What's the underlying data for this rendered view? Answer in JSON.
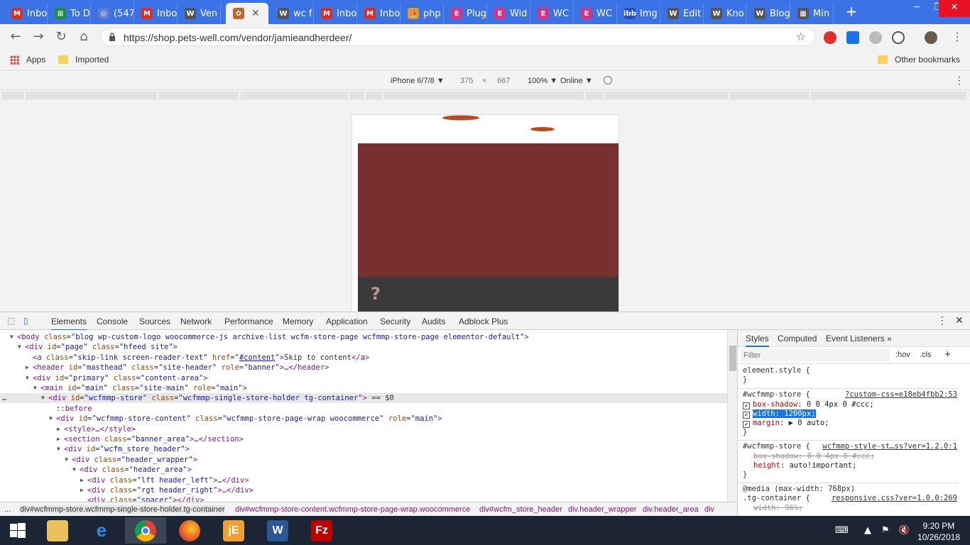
{
  "browser": {
    "tabs": [
      {
        "label": "Inbo",
        "icon": "gmail-icon",
        "color": "#d93025",
        "glyph": "M"
      },
      {
        "label": "To D",
        "icon": "sheets-icon",
        "color": "#1e8e3e",
        "glyph": "⊞"
      },
      {
        "label": "(547",
        "icon": "mail-icon",
        "color": "#5b7bd5",
        "glyph": "◎"
      },
      {
        "label": "Inbo",
        "icon": "gmail-icon",
        "color": "#d93025",
        "glyph": "M"
      },
      {
        "label": "Ven",
        "icon": "wp-icon",
        "color": "#555555",
        "glyph": "W"
      },
      {
        "label": "",
        "icon": "pets-well-icon",
        "color": "#c0672c",
        "glyph": "✿",
        "active": true
      },
      {
        "label": "wc f",
        "icon": "wp-icon",
        "color": "#555555",
        "glyph": "W"
      },
      {
        "label": "Inbo",
        "icon": "gmail-icon",
        "color": "#d93025",
        "glyph": "M"
      },
      {
        "label": "Inbo",
        "icon": "gmail-icon",
        "color": "#d93025",
        "glyph": "M"
      },
      {
        "label": "php",
        "icon": "sailboat-icon",
        "color": "#e09a28",
        "glyph": "⛵"
      },
      {
        "label": "Plug",
        "icon": "elementor-icon",
        "color": "#d63384",
        "glyph": "E"
      },
      {
        "label": "Wid",
        "icon": "elementor-icon",
        "color": "#d63384",
        "glyph": "E"
      },
      {
        "label": "WC",
        "icon": "elementor-icon",
        "color": "#d63384",
        "glyph": "E"
      },
      {
        "label": "WC",
        "icon": "elementor-icon",
        "color": "#d63384",
        "glyph": "E"
      },
      {
        "label": "Img",
        "icon": "ibb-icon",
        "color": "#2a4fb4",
        "glyph": "ibb"
      },
      {
        "label": "Edit",
        "icon": "wp-icon",
        "color": "#555555",
        "glyph": "W"
      },
      {
        "label": "Kno",
        "icon": "wp-icon",
        "color": "#555555",
        "glyph": "W"
      },
      {
        "label": "Blog",
        "icon": "wp-icon",
        "color": "#555555",
        "glyph": "W"
      },
      {
        "label": "Min",
        "icon": "film-icon",
        "color": "#555555",
        "glyph": "▦"
      }
    ],
    "new_tab": "+",
    "url": "https://shop.pets-well.com/vendor/jamieandherdeer/",
    "bookmarks": {
      "apps": "Apps",
      "imported": "Imported",
      "other": "Other bookmarks"
    }
  },
  "device_toolbar": {
    "device": "iPhone 6/7/8 ▼",
    "width": "375",
    "times": "×",
    "height": "667",
    "zoom": "100% ▼",
    "network": "Online ▼"
  },
  "page_preview": {
    "banner_color": "#772f30",
    "bar_color": "#3a3a3a",
    "placeholder_glyph": "?"
  },
  "devtools": {
    "tabs": [
      "Elements",
      "Console",
      "Sources",
      "Network",
      "Performance",
      "Memory",
      "Application",
      "Security",
      "Audits",
      "Adblock Plus"
    ],
    "dom_lines": [
      {
        "indent": 0,
        "arrow": "▼",
        "html": "<span class='tag'>&lt;body</span> <span class='attr'>class</span>=<span class='val'>\"blog wp-custom-logo woocommerce-js archive-list wcfm-store-page wcfmmp-store-page elementor-default\"</span><span class='tag'>&gt;</span>"
      },
      {
        "indent": 1,
        "arrow": "▼",
        "html": "<span class='tag'>&lt;div</span> <span class='attr'>id</span>=<span class='val'>\"page\"</span> <span class='attr'>class</span>=<span class='val'>\"hfeed site\"</span><span class='tag'>&gt;</span>"
      },
      {
        "indent": 2,
        "arrow": "",
        "html": "<span class='tag'>&lt;a</span> <span class='attr'>class</span>=<span class='val'>\"skip-link screen-reader-text\"</span> <span class='attr'>href</span>=<span class='val'>\"<u>#content</u>\"</span><span class='tag'>&gt;</span>Skip to content<span class='tag'>&lt;/a&gt;</span>"
      },
      {
        "indent": 2,
        "arrow": "▶",
        "html": "<span class='tag'>&lt;header</span> <span class='attr'>id</span>=<span class='val'>\"masthead\"</span> <span class='attr'>class</span>=<span class='val'>\"site-header\"</span> <span class='attr'>role</span>=<span class='val'>\"banner\"</span><span class='tag'>&gt;</span>…<span class='tag'>&lt;/header&gt;</span>"
      },
      {
        "indent": 2,
        "arrow": "▼",
        "html": "<span class='tag'>&lt;div</span> <span class='attr'>id</span>=<span class='val'>\"primary\"</span> <span class='attr'>class</span>=<span class='val'>\"content-area\"</span><span class='tag'>&gt;</span>"
      },
      {
        "indent": 3,
        "arrow": "▼",
        "html": "<span class='tag'>&lt;main</span> <span class='attr'>id</span>=<span class='val'>\"main\"</span> <span class='attr'>class</span>=<span class='val'>\"site-main\"</span> <span class='attr'>role</span>=<span class='val'>\"main\"</span><span class='tag'>&gt;</span>"
      },
      {
        "indent": 4,
        "arrow": "▼",
        "selected": true,
        "html": "<span class='tag'>&lt;div</span> <span class='attr'>id</span>=<span class='val'>\"wcfmmp-store\"</span> <span class='attr'>class</span>=<span class='val'>\"wcfmmp-single-store-holder tg-container\"</span><span class='tag'>&gt;</span> == $0"
      },
      {
        "indent": 5,
        "arrow": "",
        "html": "<span class='pseudo'>::before</span>"
      },
      {
        "indent": 5,
        "arrow": "▼",
        "html": "<span class='tag'>&lt;div</span> <span class='attr'>id</span>=<span class='val'>\"wcfmmp-store-content\"</span> <span class='attr'>class</span>=<span class='val'>\"wcfmmp-store-page-wrap woocommerce\"</span> <span class='attr'>role</span>=<span class='val'>\"main\"</span><span class='tag'>&gt;</span>"
      },
      {
        "indent": 6,
        "arrow": "▶",
        "html": "<span class='tag'>&lt;style&gt;</span>…<span class='tag'>&lt;/style&gt;</span>"
      },
      {
        "indent": 6,
        "arrow": "▶",
        "html": "<span class='tag'>&lt;section</span> <span class='attr'>class</span>=<span class='val'>\"banner_area\"</span><span class='tag'>&gt;</span>…<span class='tag'>&lt;/section&gt;</span>"
      },
      {
        "indent": 6,
        "arrow": "▼",
        "html": "<span class='tag'>&lt;div</span> <span class='attr'>id</span>=<span class='val'>\"wcfm_store_header\"</span><span class='tag'>&gt;</span>"
      },
      {
        "indent": 7,
        "arrow": "▼",
        "html": "<span class='tag'>&lt;div</span> <span class='attr'>class</span>=<span class='val'>\"header_wrapper\"</span><span class='tag'>&gt;</span>"
      },
      {
        "indent": 8,
        "arrow": "▼",
        "html": "<span class='tag'>&lt;div</span> <span class='attr'>class</span>=<span class='val'>\"header_area\"</span><span class='tag'>&gt;</span>"
      },
      {
        "indent": 9,
        "arrow": "▶",
        "html": "<span class='tag'>&lt;div</span> <span class='attr'>class</span>=<span class='val'>\"lft header_left\"</span><span class='tag'>&gt;</span>…<span class='tag'>&lt;/div&gt;</span>"
      },
      {
        "indent": 9,
        "arrow": "▶",
        "html": "<span class='tag'>&lt;div</span> <span class='attr'>class</span>=<span class='val'>\"rgt header_right\"</span><span class='tag'>&gt;</span>…<span class='tag'>&lt;/div&gt;</span>"
      },
      {
        "indent": 9,
        "arrow": "",
        "html": "<span class='tag'>&lt;div</span> <span class='attr'>class</span>=<span class='val'>\"spacer\"</span><span class='tag'>&gt;&lt;/div&gt;</span>"
      }
    ],
    "styles_tabs": [
      "Styles",
      "Computed",
      "Event Listeners",
      "»"
    ],
    "filter_placeholder": "Filter",
    "filter_hov": ":hov",
    "filter_cls": ".cls",
    "filter_add": "+",
    "element_style_open": "element.style {",
    "close_brace": "}",
    "rule1": {
      "selector": "#wcfmmp-store {",
      "source": "?custom-css=e18eb4fbb2:53",
      "box_shadow_name": "box-shadow",
      "box_shadow_value": "0 0 4px 0 #ccc;",
      "width": "width: 1200px;",
      "margin_name": "margin",
      "margin_value": "▶ 0 auto;"
    },
    "rule2": {
      "selector": "#wcfmmp-store {",
      "source": "wcfmmp-style-st…ss?ver=1.2.0:1",
      "box_shadow": "box-shadow: 0 0 4px 0 #ccc;",
      "height_name": "height",
      "height_value": "auto!important;"
    },
    "rule3": {
      "media": "@media (max-width: 768px)",
      "selector": ".tg-container {",
      "source": "responsive.css?ver=1.0.0:269",
      "width": "width: 96%;"
    },
    "breadcrumbs": [
      "div#wcfmmp-store.wcfmmp-single-store-holder.tg-container",
      "div#wcfmmp-store-content.wcfmmp-store-page-wrap.woocommerce",
      "div#wcfm_store_header",
      "div.header_wrapper",
      "div.header_area",
      "div"
    ],
    "breadcrumb_ellipsis": "..."
  },
  "taskbar": {
    "time": "9:20 PM",
    "date": "10/26/2018"
  }
}
